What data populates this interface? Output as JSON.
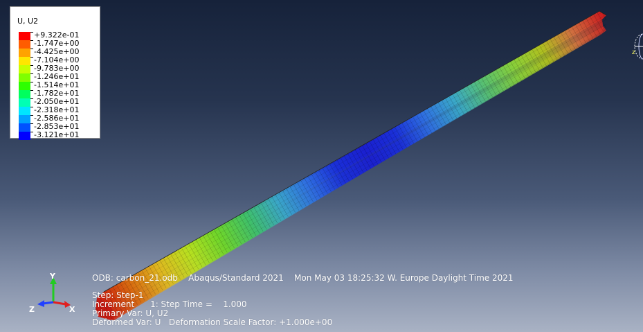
{
  "legend": {
    "title": "U, U2",
    "entries": [
      {
        "label": "+9.322e-01",
        "color": "#ff0000"
      },
      {
        "label": "-1.747e+00",
        "color": "#ff5c00"
      },
      {
        "label": "-4.425e+00",
        "color": "#ffa200"
      },
      {
        "label": "-7.104e+00",
        "color": "#ffe600"
      },
      {
        "label": "-9.783e+00",
        "color": "#c7ff00"
      },
      {
        "label": "-1.246e+01",
        "color": "#7fff00"
      },
      {
        "label": "-1.514e+01",
        "color": "#2dff00"
      },
      {
        "label": "-1.782e+01",
        "color": "#00ff5d"
      },
      {
        "label": "-2.050e+01",
        "color": "#00ffb4"
      },
      {
        "label": "-2.318e+01",
        "color": "#00e6ff"
      },
      {
        "label": "-2.586e+01",
        "color": "#00a2ff"
      },
      {
        "label": "-2.853e+01",
        "color": "#0052ff"
      },
      {
        "label": "-3.121e+01",
        "color": "#0000ff"
      }
    ]
  },
  "info": {
    "line1": "ODB: carbon_21.odb    Abaqus/Standard 2021    Mon May 03 18:25:32 W. Europe Daylight Time 2021",
    "line2": "Step: Step-1",
    "line3": "Increment      1: Step Time =    1.000",
    "line4": "Primary Var: U, U2",
    "line5": "Deformed Var: U   Deformation Scale Factor: +1.000e+00"
  },
  "triad": {
    "y_label": "Y",
    "x_label": "X",
    "z_label": "Z",
    "y_color": "#22cc22",
    "x_color": "#e02020",
    "z_color": "#2040ff"
  },
  "triad_right": {
    "z_label": "z"
  },
  "beam": {
    "contour_stops": [
      "#cc1a10",
      "#d86a10",
      "#dfb820",
      "#b8e020",
      "#6fd62a",
      "#3fc06a",
      "#3aa6c8",
      "#2f6fe0",
      "#1a2fd8",
      "#1a1fd0",
      "#1a2fd8",
      "#2f70e0",
      "#3aa8c8",
      "#58c070",
      "#88cf3a",
      "#b0c020",
      "#d07040",
      "#cc2020"
    ]
  }
}
